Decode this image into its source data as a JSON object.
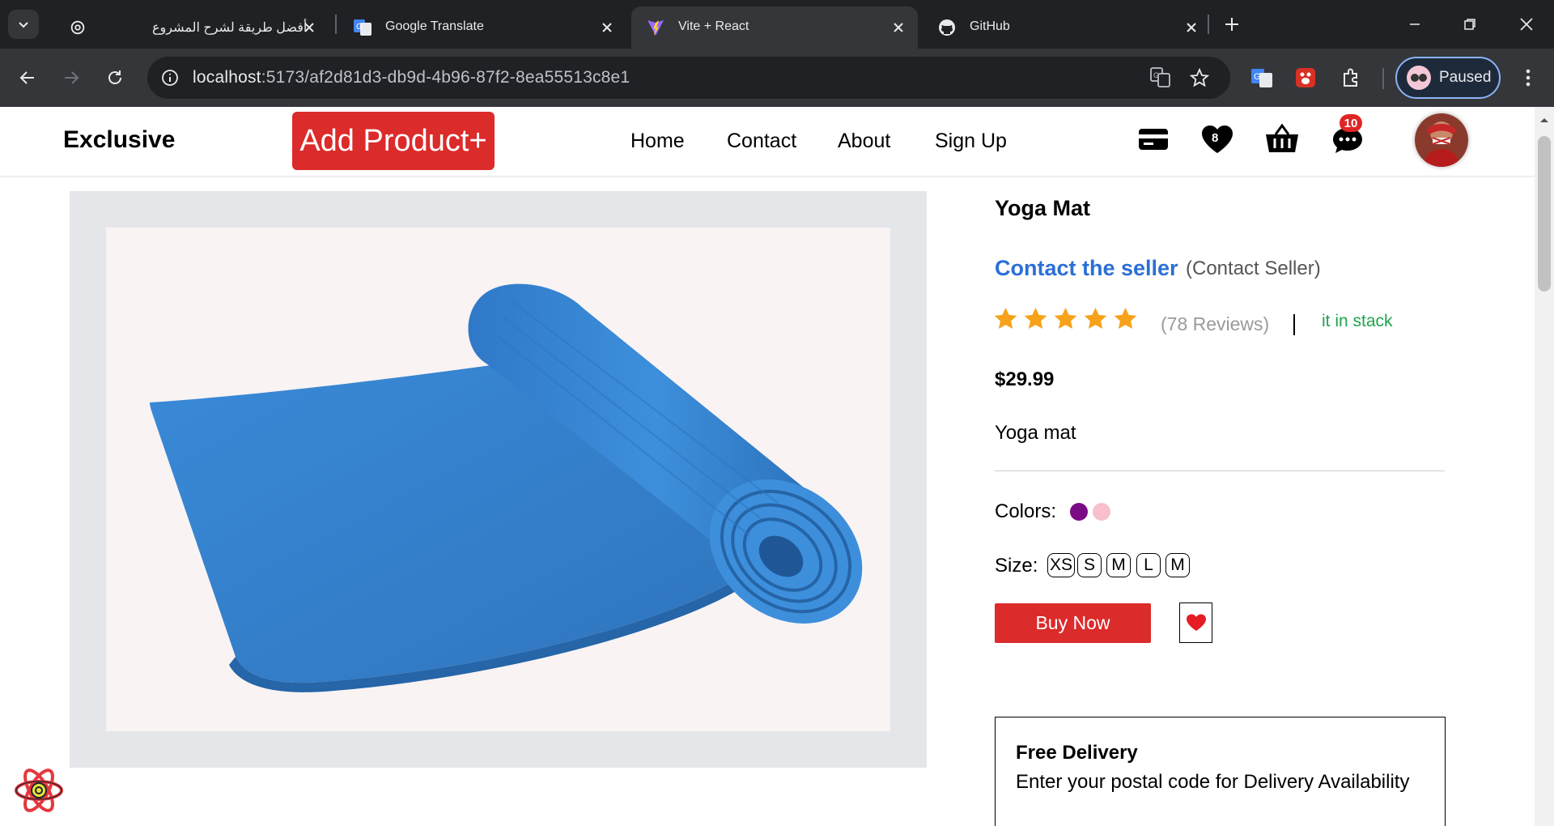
{
  "browser": {
    "tabs": [
      {
        "title": "أفضل طريقة لشرح المشروع",
        "favicon": "openai-icon",
        "active": false
      },
      {
        "title": "Google Translate",
        "favicon": "google-translate-icon",
        "active": false
      },
      {
        "title": "Vite + React",
        "favicon": "vite-icon",
        "active": true
      },
      {
        "title": "GitHub",
        "favicon": "github-icon",
        "active": false
      }
    ],
    "url_host": "localhost",
    "url_path": ":5173/af2d81d3-db9d-4b96-87f2-8ea55513c8e1",
    "profile_label": "Paused"
  },
  "header": {
    "brand": "Exclusive",
    "add_product": "Add Product+",
    "nav": [
      "Home",
      "Contact",
      "About",
      "Sign Up"
    ],
    "wishlist_count": "8",
    "messages_count": "10"
  },
  "product": {
    "name": "Yoga Mat",
    "contact_link": "Contact the seller",
    "contact_sub": "(Contact Seller)",
    "rating": 5,
    "rating_max": 5,
    "reviews": "(78 Reviews)",
    "stock": "it in stack",
    "price": "$29.99",
    "description": "Yoga mat",
    "colors_label": "Colors:",
    "colors": [
      "#7b0a85",
      "#f7c0cc"
    ],
    "size_label": "Size:",
    "sizes": [
      "XS",
      "S",
      "M",
      "L",
      "M"
    ],
    "buy_now": "Buy Now"
  },
  "delivery": {
    "title": "Free Delivery",
    "text": "Enter your postal code for Delivery Availability"
  },
  "colors": {
    "accent_red": "#db2b2b",
    "link_blue": "#2b6fd6",
    "stock_green": "#1fa34d",
    "star_orange": "#f7a21b",
    "mat_blue": "#2f80cf"
  }
}
